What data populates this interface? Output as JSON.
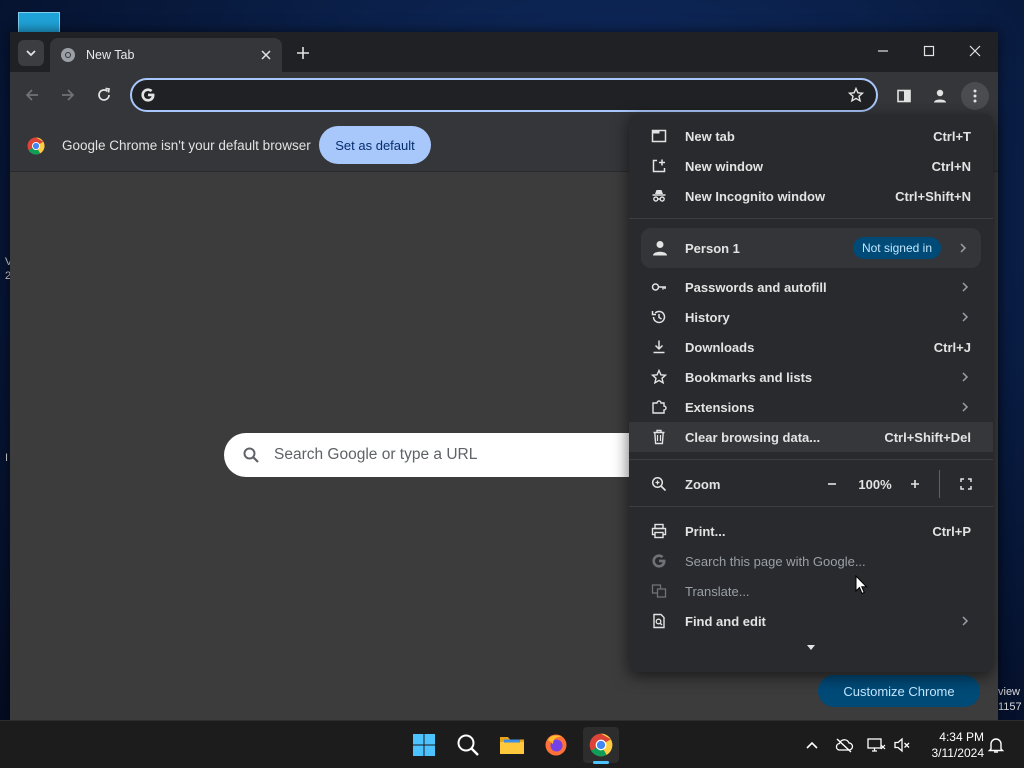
{
  "desktop": {
    "edge_texts_left": [
      "V",
      "2",
      "I"
    ],
    "edge_texts_right": [
      "view",
      "1157"
    ]
  },
  "window": {
    "tab": {
      "title": "New Tab"
    },
    "omnibox": {
      "value": "",
      "placeholder": ""
    }
  },
  "infobar": {
    "message": "Google Chrome isn't your default browser",
    "button_label": "Set as default"
  },
  "ntp": {
    "search_placeholder": "Search Google or type a URL",
    "customize_label": "Customize Chrome"
  },
  "menu": {
    "new_tab": {
      "label": "New tab",
      "shortcut": "Ctrl+T"
    },
    "new_window": {
      "label": "New window",
      "shortcut": "Ctrl+N"
    },
    "new_incognito": {
      "label": "New Incognito window",
      "shortcut": "Ctrl+Shift+N"
    },
    "person": {
      "label": "Person 1",
      "badge": "Not signed in"
    },
    "passwords": {
      "label": "Passwords and autofill"
    },
    "history": {
      "label": "History"
    },
    "downloads": {
      "label": "Downloads",
      "shortcut": "Ctrl+J"
    },
    "bookmarks": {
      "label": "Bookmarks and lists"
    },
    "extensions": {
      "label": "Extensions"
    },
    "clear_data": {
      "label": "Clear browsing data...",
      "shortcut": "Ctrl+Shift+Del"
    },
    "zoom": {
      "label": "Zoom",
      "value": "100%"
    },
    "print": {
      "label": "Print...",
      "shortcut": "Ctrl+P"
    },
    "search_page": {
      "label": "Search this page with Google..."
    },
    "translate": {
      "label": "Translate..."
    },
    "find_edit": {
      "label": "Find and edit"
    }
  },
  "taskbar": {
    "clock_time": "4:34 PM",
    "clock_date": "3/11/2024"
  },
  "colors": {
    "accent": "#a8c7fa",
    "menu_bg": "#282a2d",
    "badge_bg": "#004a77",
    "windows_accent": "#4cc2ff"
  }
}
